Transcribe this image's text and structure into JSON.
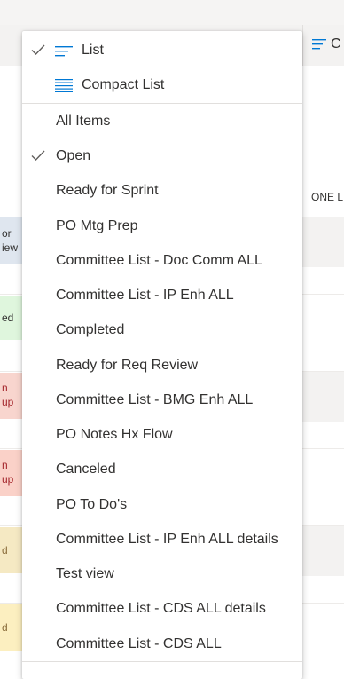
{
  "column_header": {
    "label_fragment": "C",
    "icon": "list-lines-icon"
  },
  "column_subheader": "ONE L",
  "left_pills": [
    {
      "lines": [
        "or",
        "iew"
      ],
      "bg": "#dfe6ef",
      "color": "#323130"
    },
    {
      "lines": [
        "ed"
      ],
      "bg": "#dff6dd",
      "color": "#323130"
    },
    {
      "lines": [
        "n",
        "up"
      ],
      "bg": "#f8d5ce",
      "color": "#a4262c"
    },
    {
      "lines": [
        "n",
        "up"
      ],
      "bg": "#fad1c8",
      "color": "#a4262c"
    },
    {
      "lines": [
        "d"
      ],
      "bg": "#f5e9c3",
      "color": "#8a6d3b"
    },
    {
      "lines": [
        "d"
      ],
      "bg": "#fcefc0",
      "color": "#8a6d3b"
    }
  ],
  "menu": {
    "layout_options": [
      {
        "label": "List",
        "checked": true,
        "icon": "list-icon"
      },
      {
        "label": "Compact List",
        "checked": false,
        "icon": "compact-list-icon"
      }
    ],
    "views": [
      {
        "label": "All Items",
        "checked": false
      },
      {
        "label": "Open",
        "checked": true
      },
      {
        "label": "Ready for Sprint",
        "checked": false
      },
      {
        "label": "PO Mtg Prep",
        "checked": false
      },
      {
        "label": "Committee List - Doc Comm ALL",
        "checked": false
      },
      {
        "label": "Committee List - IP Enh ALL",
        "checked": false
      },
      {
        "label": "Completed",
        "checked": false
      },
      {
        "label": "Ready for Req Review",
        "checked": false
      },
      {
        "label": "Committee List - BMG Enh ALL",
        "checked": false
      },
      {
        "label": "PO Notes Hx Flow",
        "checked": false
      },
      {
        "label": "Canceled",
        "checked": false
      },
      {
        "label": "PO To Do's",
        "checked": false
      },
      {
        "label": "Committee List - IP Enh ALL details",
        "checked": false
      },
      {
        "label": "Test view",
        "checked": false
      },
      {
        "label": "Committee List - CDS ALL details",
        "checked": false
      },
      {
        "label": "Committee List - CDS ALL",
        "checked": false
      }
    ]
  },
  "colors": {
    "accent": "#0078d4",
    "text": "#323130",
    "check": "#605e5c"
  }
}
